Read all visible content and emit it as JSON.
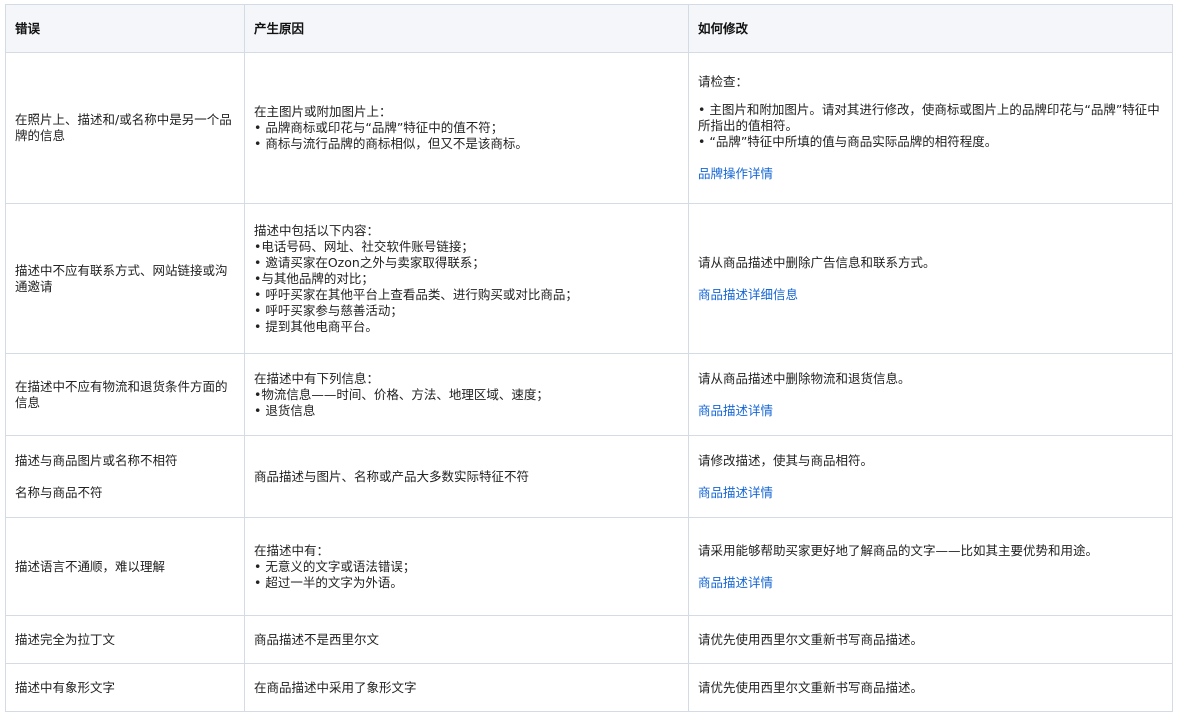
{
  "headers": {
    "error": "错误",
    "cause": "产生原因",
    "fix": "如何修改"
  },
  "rows": [
    {
      "error": "在照片上、描述和/或名称中是另一个品牌的信息",
      "cause_lines": [
        "在主图片或附加图片上：",
        "• 品牌商标或印花与“品牌”特征中的值不符；",
        "• 商标与流行品牌的商标相似，但又不是该商标。"
      ],
      "fix_intro": "请检查：",
      "fix_lines": [
        "• 主图片和附加图片。请对其进行修改，使商标或图片上的品牌印花与“品牌”特征中所指出的值相符。",
        "• “品牌”特征中所填的值与商品实际品牌的相符程度。"
      ],
      "fix_link": "品牌操作详情"
    },
    {
      "error": "描述中不应有联系方式、网站链接或沟通邀请",
      "cause_lines": [
        "描述中包括以下内容：",
        "•电话号码、网址、社交软件账号链接；",
        "• 邀请买家在Ozon之外与卖家取得联系；",
        "•与其他品牌的对比；",
        "• 呼吁买家在其他平台上查看品类、进行购买或对比商品；",
        "• 呼吁买家参与慈善活动；",
        "• 提到其他电商平台。"
      ],
      "fix_text": "请从商品描述中删除广告信息和联系方式。",
      "fix_link": "商品描述详细信息"
    },
    {
      "error": "在描述中不应有物流和退货条件方面的信息",
      "cause_lines": [
        "在描述中有下列信息：",
        "•物流信息——时间、价格、方法、地理区域、速度；",
        "• 退货信息"
      ],
      "fix_text": "请从商品描述中删除物流和退货信息。",
      "fix_link": "商品描述详情"
    },
    {
      "error_a": "描述与商品图片或名称不相符",
      "error_b": "名称与商品不符",
      "cause": "商品描述与图片、名称或产品大多数实际特征不符",
      "fix_text": "请修改描述，使其与商品相符。",
      "fix_link": "商品描述详情"
    },
    {
      "error": "描述语言不通顺，难以理解",
      "cause_lines": [
        "在描述中有：",
        "• 无意义的文字或语法错误；",
        "• 超过一半的文字为外语。"
      ],
      "fix_text": "请采用能够帮助买家更好地了解商品的文字——比如其主要优势和用途。",
      "fix_link": "商品描述详情"
    },
    {
      "error": "描述完全为拉丁文",
      "cause": "商品描述不是西里尔文",
      "fix_text": "请优先使用西里尔文重新书写商品描述。"
    },
    {
      "error": "描述中有象形文字",
      "cause": "在商品描述中采用了象形文字",
      "fix_text": "请优先使用西里尔文重新书写商品描述。"
    }
  ],
  "colors": {
    "link": "#1466d6",
    "header_bg": "#f4f6f9",
    "border": "#d4dbe5"
  }
}
